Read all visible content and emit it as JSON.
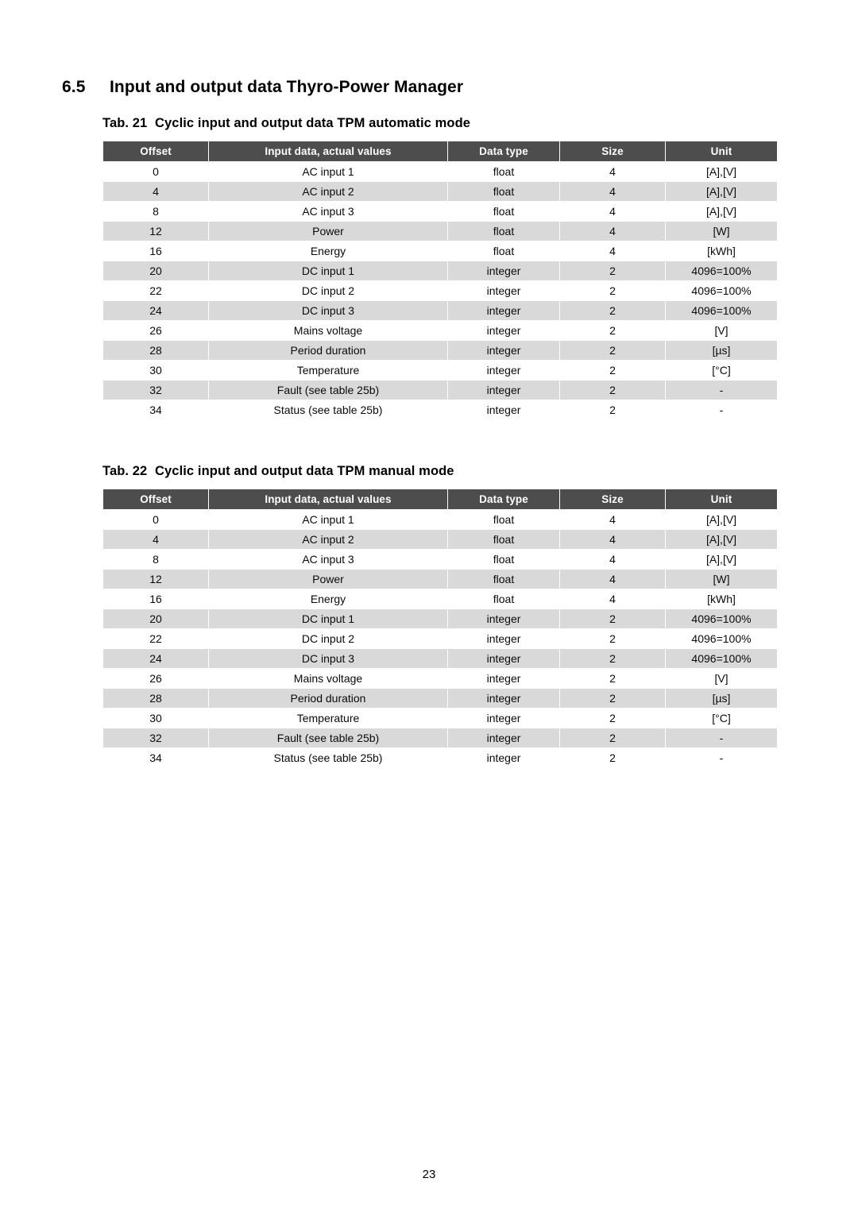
{
  "document": {
    "page_number": "23"
  },
  "section": {
    "number": "6.5",
    "title": "Input and output data Thyro-Power Manager"
  },
  "theme": {
    "header_bg": "#4d4d4d",
    "header_text": "#ffffff",
    "row_shaded_bg": "#d9d9d9",
    "row_plain_bg": "#ffffff",
    "text": "#000000"
  },
  "columns": {
    "offset": "Offset",
    "description": "Input data, actual values",
    "data_type": "Data type",
    "size": "Size",
    "unit": "Unit"
  },
  "tables": [
    {
      "id": "tab-21",
      "caption_label": "Tab. 21",
      "caption_text": "Cyclic input and output data TPM automatic mode",
      "headers": [
        "Offset",
        "Input data, actual values",
        "Data type",
        "Size",
        "Unit"
      ],
      "rows": [
        {
          "offset": "0",
          "description": "AC input 1",
          "data_type": "float",
          "size": "4",
          "unit": "[A],[V]"
        },
        {
          "offset": "4",
          "description": "AC input 2",
          "data_type": "float",
          "size": "4",
          "unit": "[A],[V]"
        },
        {
          "offset": "8",
          "description": "AC input 3",
          "data_type": "float",
          "size": "4",
          "unit": "[A],[V]"
        },
        {
          "offset": "12",
          "description": "Power",
          "data_type": "float",
          "size": "4",
          "unit": "[W]"
        },
        {
          "offset": "16",
          "description": "Energy",
          "data_type": "float",
          "size": "4",
          "unit": "[kWh]"
        },
        {
          "offset": "20",
          "description": "DC input 1",
          "data_type": "integer",
          "size": "2",
          "unit": "4096=100%"
        },
        {
          "offset": "22",
          "description": "DC input 2",
          "data_type": "integer",
          "size": "2",
          "unit": "4096=100%"
        },
        {
          "offset": "24",
          "description": "DC input 3",
          "data_type": "integer",
          "size": "2",
          "unit": "4096=100%"
        },
        {
          "offset": "26",
          "description": "Mains voltage",
          "data_type": "integer",
          "size": "2",
          "unit": "[V]"
        },
        {
          "offset": "28",
          "description": "Period duration",
          "data_type": "integer",
          "size": "2",
          "unit": "[µs]"
        },
        {
          "offset": "30",
          "description": "Temperature",
          "data_type": "integer",
          "size": "2",
          "unit": "[°C]"
        },
        {
          "offset": "32",
          "description": "Fault (see table 25b)",
          "data_type": "integer",
          "size": "2",
          "unit": "-"
        },
        {
          "offset": "34",
          "description": "Status (see table 25b)",
          "data_type": "integer",
          "size": "2",
          "unit": "-"
        }
      ]
    },
    {
      "id": "tab-22",
      "caption_label": "Tab. 22",
      "caption_text": "Cyclic input and output data TPM manual mode",
      "headers": [
        "Offset",
        "Input data, actual values",
        "Data type",
        "Size",
        "Unit"
      ],
      "rows": [
        {
          "offset": "0",
          "description": "AC input 1",
          "data_type": "float",
          "size": "4",
          "unit": "[A],[V]"
        },
        {
          "offset": "4",
          "description": "AC input 2",
          "data_type": "float",
          "size": "4",
          "unit": "[A],[V]"
        },
        {
          "offset": "8",
          "description": "AC input 3",
          "data_type": "float",
          "size": "4",
          "unit": "[A],[V]"
        },
        {
          "offset": "12",
          "description": "Power",
          "data_type": "float",
          "size": "4",
          "unit": "[W]"
        },
        {
          "offset": "16",
          "description": "Energy",
          "data_type": "float",
          "size": "4",
          "unit": "[kWh]"
        },
        {
          "offset": "20",
          "description": "DC input 1",
          "data_type": "integer",
          "size": "2",
          "unit": "4096=100%"
        },
        {
          "offset": "22",
          "description": "DC input 2",
          "data_type": "integer",
          "size": "2",
          "unit": "4096=100%"
        },
        {
          "offset": "24",
          "description": "DC input 3",
          "data_type": "integer",
          "size": "2",
          "unit": "4096=100%"
        },
        {
          "offset": "26",
          "description": "Mains voltage",
          "data_type": "integer",
          "size": "2",
          "unit": "[V]"
        },
        {
          "offset": "28",
          "description": "Period duration",
          "data_type": "integer",
          "size": "2",
          "unit": "[µs]"
        },
        {
          "offset": "30",
          "description": "Temperature",
          "data_type": "integer",
          "size": "2",
          "unit": "[°C]"
        },
        {
          "offset": "32",
          "description": "Fault (see table 25b)",
          "data_type": "integer",
          "size": "2",
          "unit": "-"
        },
        {
          "offset": "34",
          "description": "Status (see table 25b)",
          "data_type": "integer",
          "size": "2",
          "unit": "-"
        }
      ]
    }
  ]
}
